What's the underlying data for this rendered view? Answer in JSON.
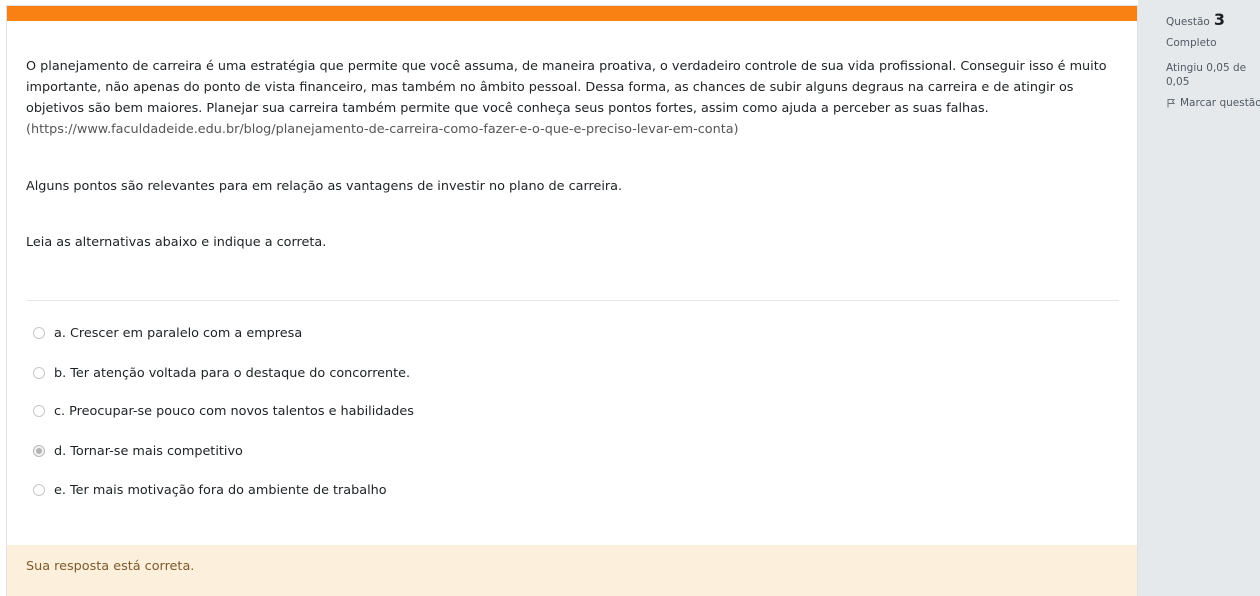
{
  "question": {
    "intro_text": "O planejamento de carreira é uma estratégia que permite que você assuma, de maneira proativa, o verdadeiro controle de sua vida profissional. Conseguir isso é muito importante, não apenas do ponto de vista financeiro, mas também no âmbito pessoal. Dessa forma, as chances de subir alguns degraus na carreira e de atingir os objetivos são bem maiores. Planejar sua carreira também permite que você conheça seus pontos fortes, assim como ajuda a perceber as suas falhas.",
    "source_link": "(https://www.faculdadeide.edu.br/blog/planejamento-de-carreira-como-fazer-e-o-que-e-preciso-levar-em-conta)",
    "statement": "Alguns pontos são relevantes para em relação as vantagens de investir no plano de carreira.",
    "instruction": "Leia as alternativas abaixo e indique a correta.",
    "answers": [
      {
        "label": "a. Crescer em paralelo com a empresa",
        "selected": false
      },
      {
        "label": "b. Ter atenção voltada para o destaque do concorrente.",
        "selected": false
      },
      {
        "label": "c. Preocupar-se pouco com novos talentos e habilidades",
        "selected": false
      },
      {
        "label": "d. Tornar-se mais competitivo",
        "selected": true
      },
      {
        "label": "e. Ter mais motivação fora do ambiente de trabalho",
        "selected": false
      }
    ],
    "feedback": "Sua resposta está correta."
  },
  "info": {
    "question_label": "Questão",
    "question_number": "3",
    "state": "Completo",
    "grade": "Atingiu 0,05 de 0,05",
    "flag_label": "Marcar questão"
  },
  "colors": {
    "accent": "#f98012",
    "feedback_bg": "#fcefdc",
    "feedback_text": "#7d5a29",
    "info_bg": "#e6e9ec"
  },
  "icons": {
    "flag": "flag-icon",
    "radio": "radio-icon"
  }
}
